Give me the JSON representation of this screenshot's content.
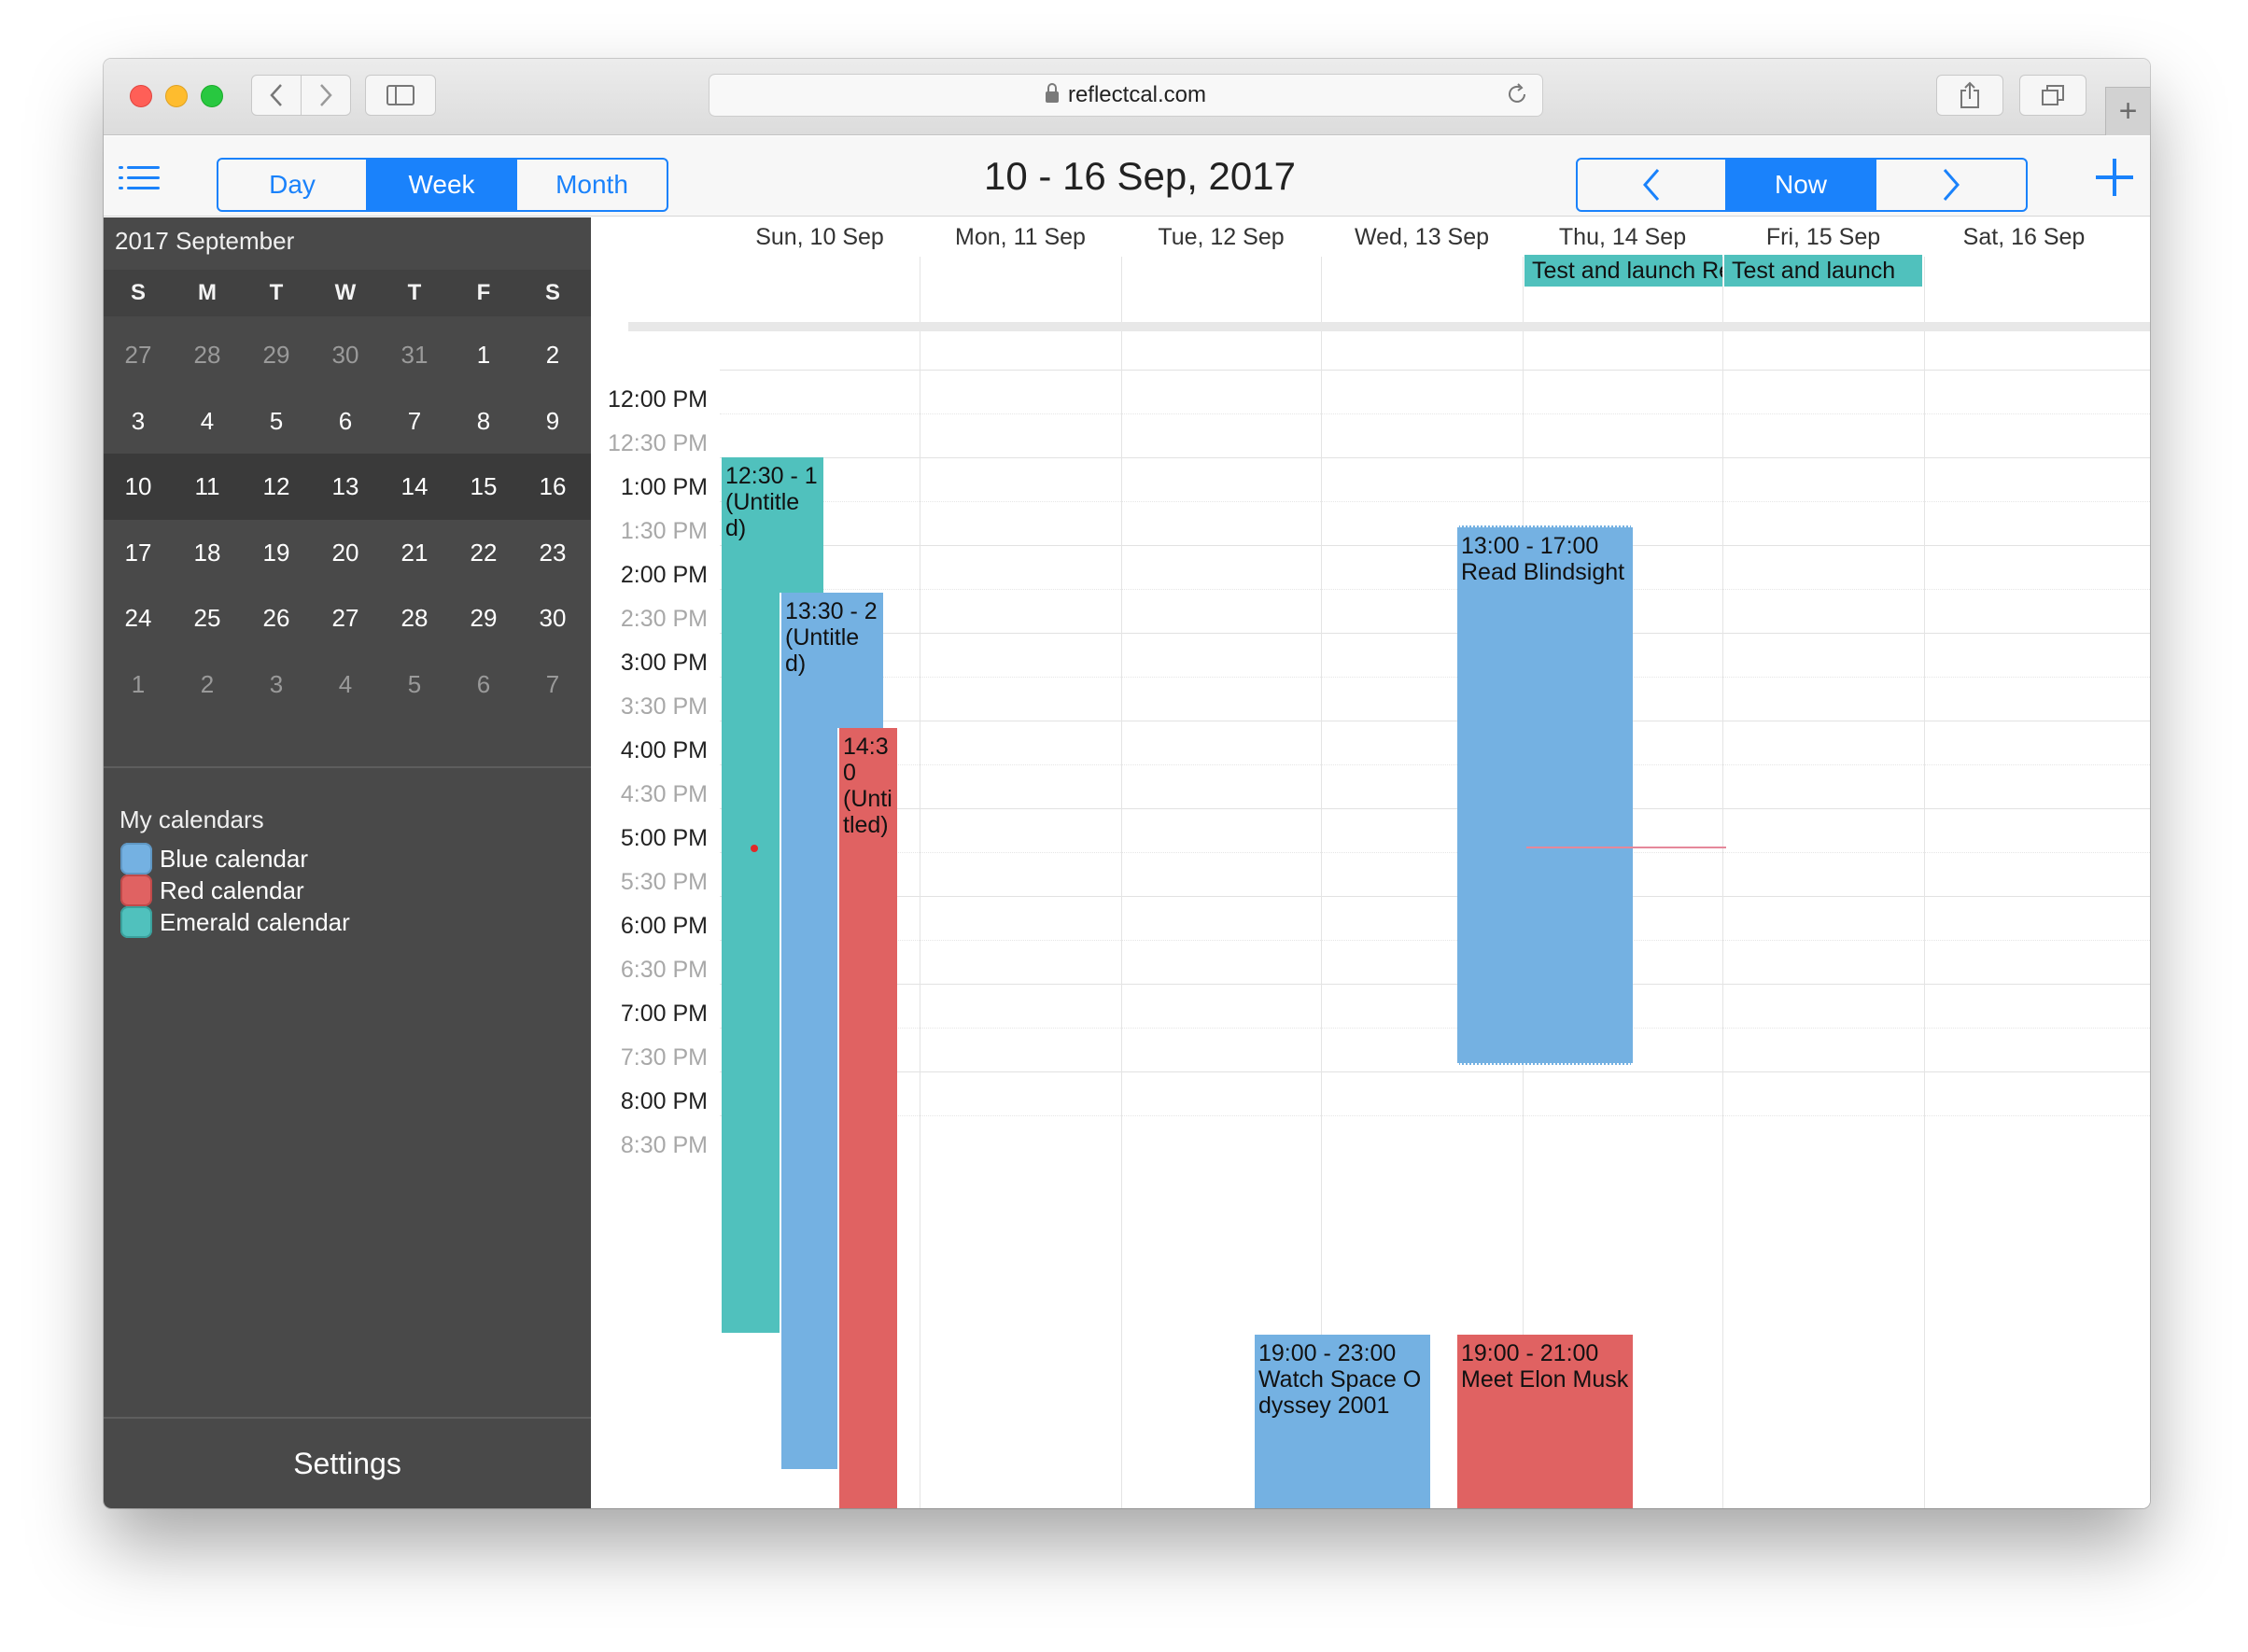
{
  "browser": {
    "url": "reflectcal.com",
    "icons": {
      "back": "chevron-left-icon",
      "forward": "chevron-right-icon",
      "sidebar": "sidebar-icon",
      "reload": "reload-icon",
      "share": "share-icon",
      "tabs": "tabs-icon",
      "new_tab": "plus-icon"
    }
  },
  "toolbar": {
    "views": [
      "Day",
      "Week",
      "Month"
    ],
    "active_view": "Week",
    "title": "10 - 16 Sep, 2017",
    "now_label": "Now",
    "icons": {
      "menu": "list-icon",
      "prev": "chevron-left-icon",
      "next": "chevron-right-icon",
      "add": "plus-icon"
    }
  },
  "mini_calendar": {
    "title": "2017 September",
    "weekdays": [
      "S",
      "M",
      "T",
      "W",
      "T",
      "F",
      "S"
    ],
    "weeks": [
      [
        "27",
        "28",
        "29",
        "30",
        "31",
        "1",
        "2"
      ],
      [
        "3",
        "4",
        "5",
        "6",
        "7",
        "8",
        "9"
      ],
      [
        "10",
        "11",
        "12",
        "13",
        "14",
        "15",
        "16"
      ],
      [
        "17",
        "18",
        "19",
        "20",
        "21",
        "22",
        "23"
      ],
      [
        "24",
        "25",
        "26",
        "27",
        "28",
        "29",
        "30"
      ],
      [
        "1",
        "2",
        "3",
        "4",
        "5",
        "6",
        "7"
      ]
    ],
    "current_week": 2
  },
  "calendars": {
    "header": "My calendars",
    "items": [
      {
        "name": "Blue calendar",
        "color": "#74b1e2"
      },
      {
        "name": "Red calendar",
        "color": "#e06262"
      },
      {
        "name": "Emerald calendar",
        "color": "#50c1bd"
      }
    ]
  },
  "settings_label": "Settings",
  "week": {
    "days": [
      "Sun, 10 Sep",
      "Mon, 11 Sep",
      "Tue, 12 Sep",
      "Wed, 13 Sep",
      "Thu, 14 Sep",
      "Fri, 15 Sep",
      "Sat, 16 Sep"
    ],
    "all_day_events": [
      {
        "text": "Test and launch Reflect",
        "calendar": "emerald"
      },
      {
        "text": "Test and launch",
        "calendar": "emerald"
      }
    ],
    "time_labels": [
      "12:00 PM",
      "12:30 PM",
      "1:00 PM",
      "1:30 PM",
      "2:00 PM",
      "2:30 PM",
      "3:00 PM",
      "3:30 PM",
      "4:00 PM",
      "4:30 PM",
      "5:00 PM",
      "5:30 PM",
      "6:00 PM",
      "6:30 PM",
      "7:00 PM",
      "7:30 PM",
      "8:00 PM",
      "8:30 PM"
    ],
    "events": [
      {
        "text": "12:30 - 1",
        "title": "(Untitled)",
        "calendar": "emerald"
      },
      {
        "text": "13:30 - 2",
        "title": "(Untitled)",
        "calendar": "blue"
      },
      {
        "text": "14:30",
        "title": "(Untitled)",
        "calendar": "red"
      },
      {
        "text": "13:00 - 17:00",
        "title": "Read Blindsight",
        "calendar": "blue"
      },
      {
        "text": "19:00 - 23:00",
        "title": "Watch Space Odyssey 2001",
        "calendar": "blue"
      },
      {
        "text": "19:00 - 21:00",
        "title": "Meet Elon Musk",
        "calendar": "red"
      }
    ]
  }
}
